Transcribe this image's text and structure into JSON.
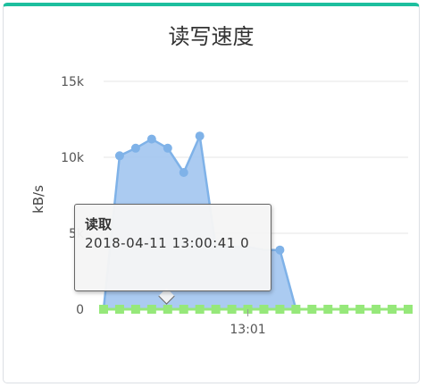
{
  "card": {
    "title": "读写速度"
  },
  "colors": {
    "accent": "#1dbf9e",
    "read_line": "#7fb2e8",
    "read_fill": "#a6c8f0",
    "write": "#96e87a"
  },
  "chart_data": {
    "type": "area",
    "title": "读写速度",
    "ylabel": "kB/s",
    "ylim": [
      0,
      15000
    ],
    "yticks": [
      {
        "value": 0,
        "label": "0"
      },
      {
        "value": 5000,
        "label": "5k"
      },
      {
        "value": 10000,
        "label": "10k"
      },
      {
        "value": 15000,
        "label": "15k"
      }
    ],
    "xticks": [
      {
        "index": 9,
        "label": "13:01"
      }
    ],
    "points": 20,
    "series": [
      {
        "name": "读取",
        "values": [
          0,
          10100,
          10600,
          11200,
          10600,
          9000,
          11400,
          4100,
          4100,
          4100,
          3900,
          3900,
          0,
          0,
          0,
          0,
          0,
          0,
          0,
          0
        ],
        "markers": [
          false,
          true,
          true,
          true,
          true,
          true,
          true,
          false,
          false,
          false,
          false,
          true,
          false,
          false,
          false,
          false,
          false,
          false,
          false,
          false
        ]
      },
      {
        "name": "",
        "values": [
          0,
          0,
          0,
          0,
          0,
          0,
          0,
          0,
          0,
          0,
          0,
          0,
          0,
          0,
          0,
          0,
          0,
          0,
          0,
          0
        ]
      }
    ],
    "tooltip": {
      "series_name": "读取",
      "time": "2018-04-11 13:00:41",
      "value": "0"
    }
  }
}
